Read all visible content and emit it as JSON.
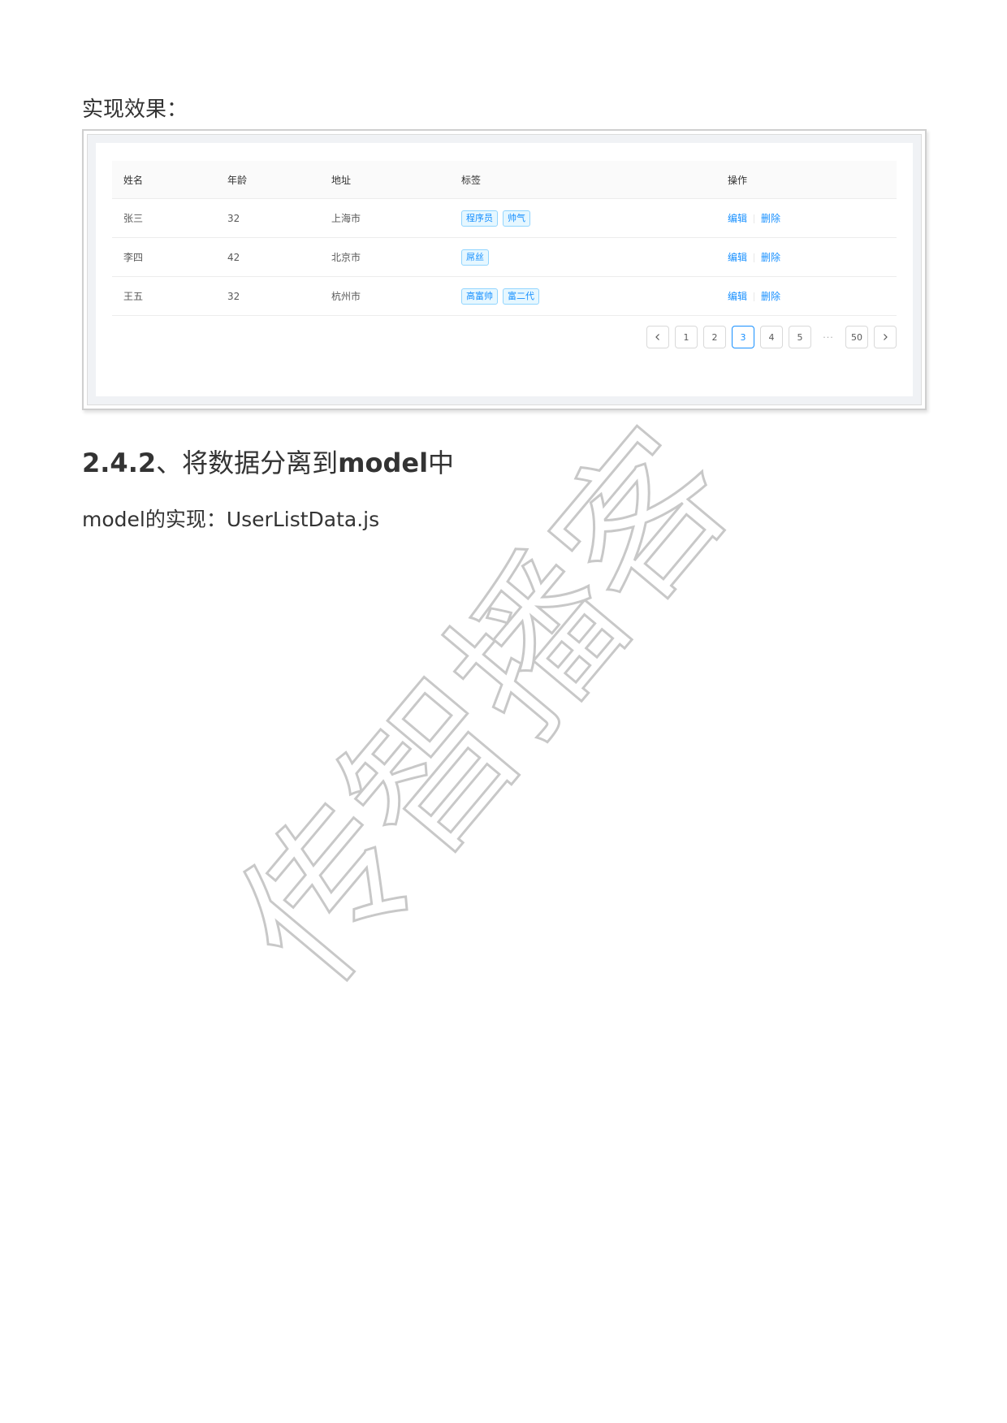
{
  "intro": "实现效果：",
  "table": {
    "columns": [
      "姓名",
      "年龄",
      "地址",
      "标签",
      "操作"
    ],
    "rows": [
      {
        "name": "张三",
        "age": "32",
        "address": "上海市",
        "tags": [
          "程序员",
          "帅气"
        ]
      },
      {
        "name": "李四",
        "age": "42",
        "address": "北京市",
        "tags": [
          "屌丝"
        ]
      },
      {
        "name": "王五",
        "age": "32",
        "address": "杭州市",
        "tags": [
          "高富帅",
          "富二代"
        ]
      }
    ],
    "actions": {
      "edit": "编辑",
      "delete": "删除"
    },
    "accent_color": "#1890ff"
  },
  "pagination": {
    "pages": [
      "1",
      "2",
      "3",
      "4",
      "5"
    ],
    "ellipsis": "···",
    "last": "50",
    "current": "3"
  },
  "heading": {
    "number": "2.4.2",
    "text_a": "、将数据分离到",
    "keyword": "model",
    "text_b": "中"
  },
  "paragraph": "model的实现：UserListData.js",
  "watermark": "传智播客"
}
